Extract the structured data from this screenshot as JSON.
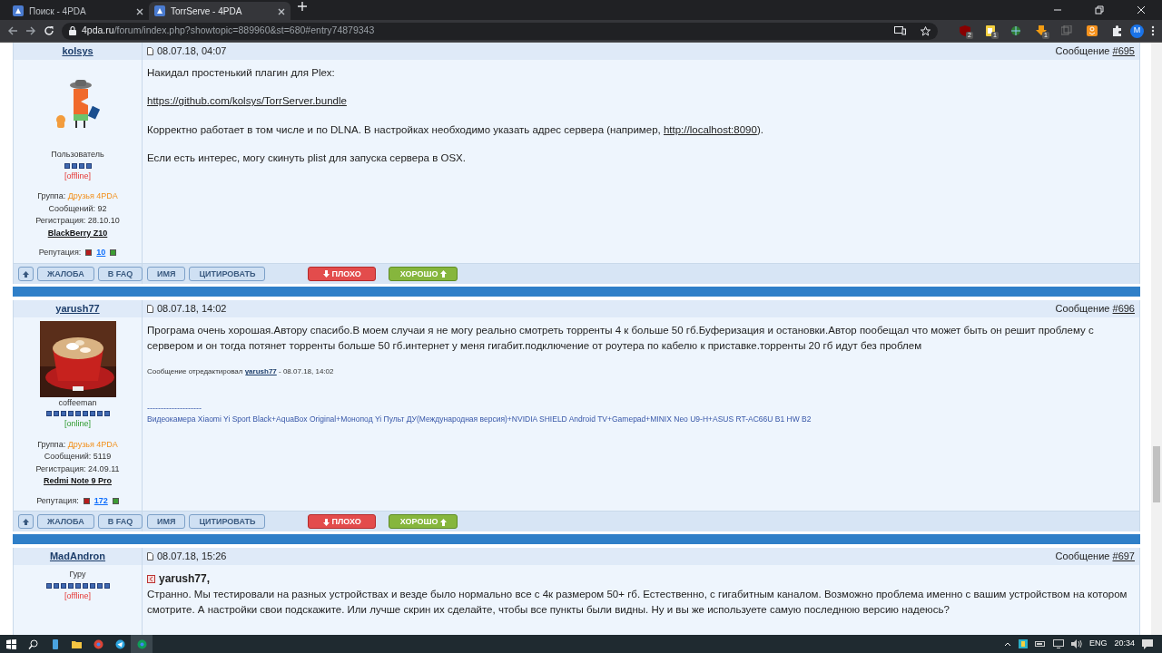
{
  "browser": {
    "tabs": [
      {
        "title": "Поиск - 4PDA",
        "selected": false
      },
      {
        "title": "TorrServe - 4PDA",
        "selected": true
      }
    ],
    "url": {
      "domain": "4pda.ru",
      "path": "/forum/index.php?showtopic=889960&st=680#entry74879343"
    },
    "extensions": [
      {
        "kind": "shield",
        "badge": "2"
      },
      {
        "kind": "note",
        "badge": "1"
      },
      {
        "kind": "globe"
      },
      {
        "kind": "download",
        "badge": "1"
      },
      {
        "kind": "tabs"
      },
      {
        "kind": "ok"
      },
      {
        "kind": "puzzle"
      }
    ],
    "profile_initial": "M"
  },
  "posts": [
    {
      "author": "kolsys",
      "date": "08.07.18, 04:07",
      "number_label": "Сообщение",
      "number": "#695",
      "user": {
        "avatar": {
          "kind": "drawing"
        },
        "rank": "Пользователь",
        "stars": 4,
        "online": false,
        "status": "[offline]",
        "group_label": "Группа:",
        "group": "Друзья 4PDA",
        "posts": "Сообщений: 92",
        "registration": "Регистрация: 28.10.10",
        "device": "BlackBerry Z10",
        "reputation_label": "Репутация:",
        "reputation": "10"
      },
      "body": [
        {
          "kind": "paragraph",
          "parts": [
            {
              "text": "Накидал простенький плагин для Plex:"
            }
          ]
        },
        {
          "kind": "paragraph",
          "parts": [
            {
              "text": "https://github.com/kolsys/TorrServer.bundle",
              "link": true
            }
          ]
        },
        {
          "kind": "paragraph",
          "parts": [
            {
              "text": "Корректно работает в том числе и по DLNA. В настройках необходимо указать адрес сервера (например, "
            },
            {
              "text": "http://localhost:8090",
              "link": true
            },
            {
              "text": ")."
            }
          ]
        },
        {
          "kind": "paragraph",
          "parts": [
            {
              "text": "Если есть интерес, могу скинуть plist для запуска сервера в OSX."
            }
          ]
        }
      ],
      "left_actions": [
        {
          "kind": "up"
        },
        {
          "kind": "plain",
          "label": "ЖАЛОБА"
        },
        {
          "kind": "plain",
          "label": "В FAQ"
        }
      ],
      "right_actions": [
        {
          "kind": "plain",
          "label": "ИМЯ"
        },
        {
          "kind": "plain",
          "label": "ЦИТИРОВАТЬ"
        },
        {
          "kind": "bad",
          "label": "ПЛОХО"
        },
        {
          "kind": "good",
          "label": "ХОРОШО"
        }
      ]
    },
    {
      "author": "yarush77",
      "date": "08.07.18, 14:02",
      "number_label": "Сообщение",
      "number": "#696",
      "user": {
        "rank": "coffeeman",
        "stars": 9,
        "online": true,
        "status": "[online]",
        "group_label": "Группа:",
        "group": "Друзья 4PDA",
        "posts": "Сообщений: 5119",
        "registration": "Регистрация: 24.09.11",
        "device": "Redmi Note 9 Pro",
        "reputation_label": "Репутация:",
        "reputation": "172"
      },
      "body": [
        {
          "kind": "paragraph",
          "parts": [
            {
              "text": "Програма очень хорошая.Автору спасибо.В моем случаи я не могу реально смотреть торренты 4 к больше 50 гб.Буферизация и остановки.Автор пообещал что может быть он решит проблему с сервером и он тогда потянет торренты больше 50 гб.интернет у меня гигабит.подключение от роутера по кабелю к приставке.торренты 20 гб идут без проблем"
            }
          ]
        },
        {
          "kind": "edit_note",
          "parts": [
            {
              "text": "Сообщение отредактировал "
            },
            {
              "text": "yarush77",
              "link": true
            },
            {
              "text": " - 08.07.18, 14:02"
            }
          ]
        },
        {
          "kind": "signature",
          "rule": "--------------------",
          "text": "Видеокамера Xiaomi Yi Sport Black+AquaBox Original+Монопод Yi Пульт ДУ(Международная версия)+NVIDIA SHIELD Android TV+Gamepad+MINIX Neo U9-H+ASUS RT-AC66U B1 HW B2"
        }
      ],
      "left_actions": [
        {
          "kind": "up"
        },
        {
          "kind": "plain",
          "label": "ЖАЛОБА"
        },
        {
          "kind": "plain",
          "label": "В FAQ"
        }
      ],
      "right_actions": [
        {
          "kind": "plain",
          "label": "ИМЯ"
        },
        {
          "kind": "plain",
          "label": "ЦИТИРОВАТЬ"
        },
        {
          "kind": "bad",
          "label": "ПЛОХО"
        },
        {
          "kind": "good",
          "label": "ХОРОШО"
        }
      ]
    },
    {
      "author": "MadAndron",
      "date": "08.07.18, 15:26",
      "number_label": "Сообщение",
      "number": "#697",
      "user": {
        "rank": "Гуру",
        "stars": 9,
        "online": false,
        "status": "[offline]"
      },
      "body": [
        {
          "kind": "reply_to",
          "name": "yarush77,"
        },
        {
          "kind": "paragraph",
          "parts": [
            {
              "text": "Странно. Мы тестировали на разных устройствах и везде было нормально все с 4к размером 50+ гб. Естественно, с гигабитным каналом. Возможно проблема именно с вашим устройством на котором смотрите. А настройки свои подскажите. Или лучше скрин их сделайте, чтобы все пункты были видны. Ну и вы же используете самую последнюю версию надеюсь?"
            }
          ]
        }
      ]
    }
  ],
  "taskbar": {
    "language": "ENG",
    "time": "20:34"
  }
}
